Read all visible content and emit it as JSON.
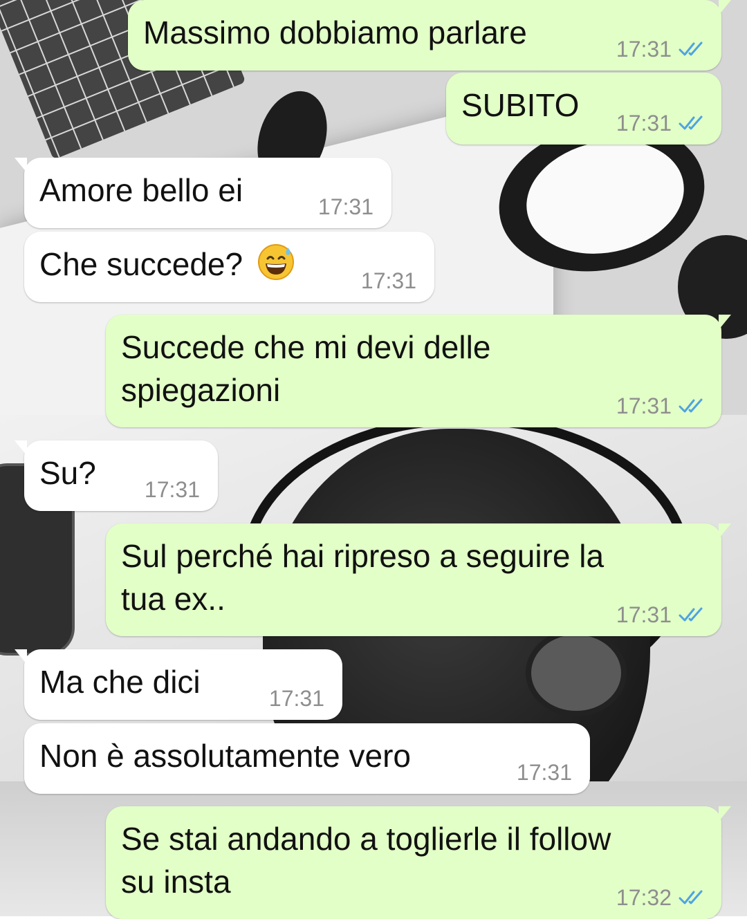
{
  "colors": {
    "outgoing_bubble": "#e2ffc7",
    "incoming_bubble": "#ffffff",
    "timestamp": "#8e8e8e",
    "read_ticks": "#4fa3e0"
  },
  "messages": [
    {
      "direction": "outgoing",
      "text": "Massimo dobbiamo parlare",
      "time": "17:31",
      "status": "read"
    },
    {
      "direction": "outgoing",
      "text": "SUBITO",
      "time": "17:31",
      "status": "read"
    },
    {
      "direction": "incoming",
      "text": "Amore bello ei",
      "time": "17:31"
    },
    {
      "direction": "incoming",
      "text": "Che succede?",
      "emoji": "grinning-face-with-sweat",
      "time": "17:31"
    },
    {
      "direction": "outgoing",
      "text": "Succede che mi devi delle\nspiegazioni",
      "time": "17:31",
      "status": "read"
    },
    {
      "direction": "incoming",
      "text": "Su?",
      "time": "17:31"
    },
    {
      "direction": "outgoing",
      "text": "Sul perché hai ripreso a seguire la\ntua ex..",
      "time": "17:31",
      "status": "read"
    },
    {
      "direction": "incoming",
      "text": "Ma che dici",
      "time": "17:31"
    },
    {
      "direction": "incoming",
      "text": "Non è assolutamente vero",
      "time": "17:31"
    },
    {
      "direction": "outgoing",
      "text": "Se stai andando a toglierle il follow\nsu insta",
      "time": "17:32",
      "status": "read"
    }
  ]
}
